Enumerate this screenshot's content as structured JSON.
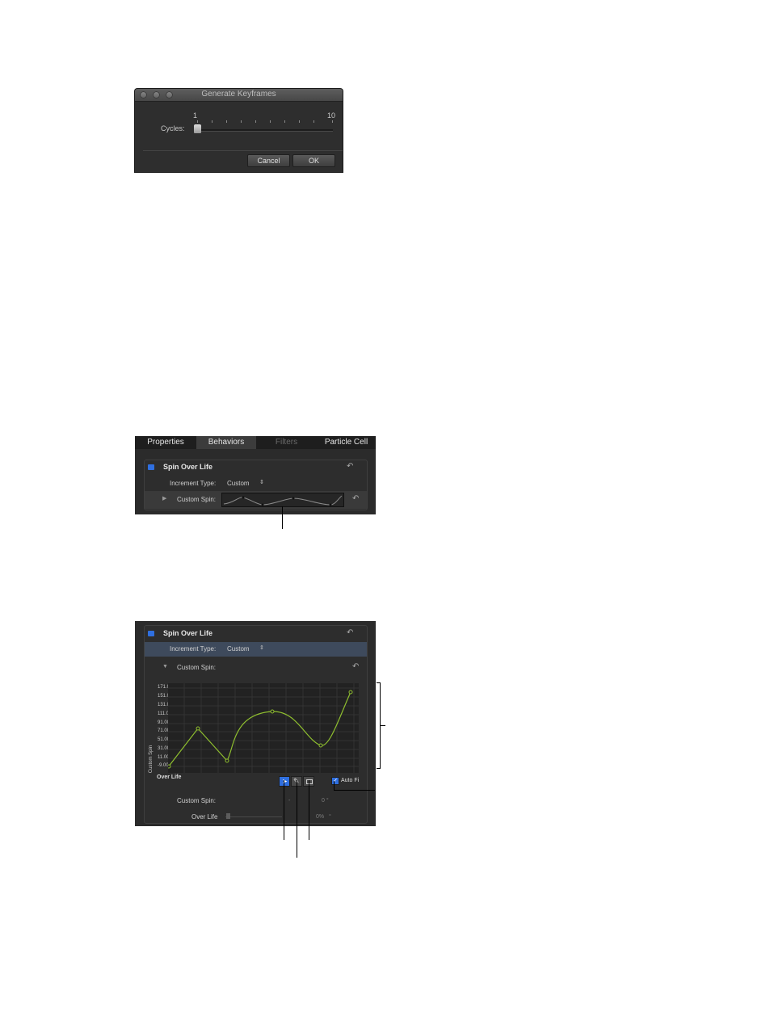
{
  "dialog": {
    "title": "Generate Keyframes",
    "cycles_label": "Cycles:",
    "slider_min": "1",
    "slider_max": "10",
    "slider_value": 1,
    "cancel_label": "Cancel",
    "ok_label": "OK"
  },
  "inspector": {
    "tabs": [
      {
        "label": "Properties",
        "state": "normal"
      },
      {
        "label": "Behaviors",
        "state": "active"
      },
      {
        "label": "Filters",
        "state": "disabled"
      },
      {
        "label": "Particle Cell",
        "state": "normal"
      }
    ],
    "behavior_title": "Spin Over Life",
    "increment_type_label": "Increment Type:",
    "increment_type_value": "Custom",
    "custom_spin_label": "Custom Spin:"
  },
  "expanded": {
    "behavior_title": "Spin Over Life",
    "increment_type_label": "Increment Type:",
    "increment_type_value": "Custom",
    "custom_spin_label": "Custom Spin:",
    "y_axis_label": "Custom Spin",
    "x_axis_label": "Over Life",
    "y_ticks": [
      "171.00",
      "151.00",
      "131.00",
      "111.00",
      "91.00",
      "71.00",
      "51.00",
      "31.00",
      "11.00",
      "-9.00"
    ],
    "auto_fit_label": "Auto Fi",
    "auto_fit_checked": true,
    "readout_spin_label": "Custom Spin:",
    "readout_spin_value": "0 °",
    "readout_life_label": "Over Life",
    "readout_life_value": "0%",
    "tools": [
      "select-tool-icon",
      "pencil-tool-icon",
      "box-tool-icon"
    ],
    "curve_color": "#8fbf2f"
  },
  "colors": {
    "panel_bg": "#2b2b2b",
    "accent_blue": "#2f6fe0",
    "selection_row": "#3e4a5c"
  }
}
